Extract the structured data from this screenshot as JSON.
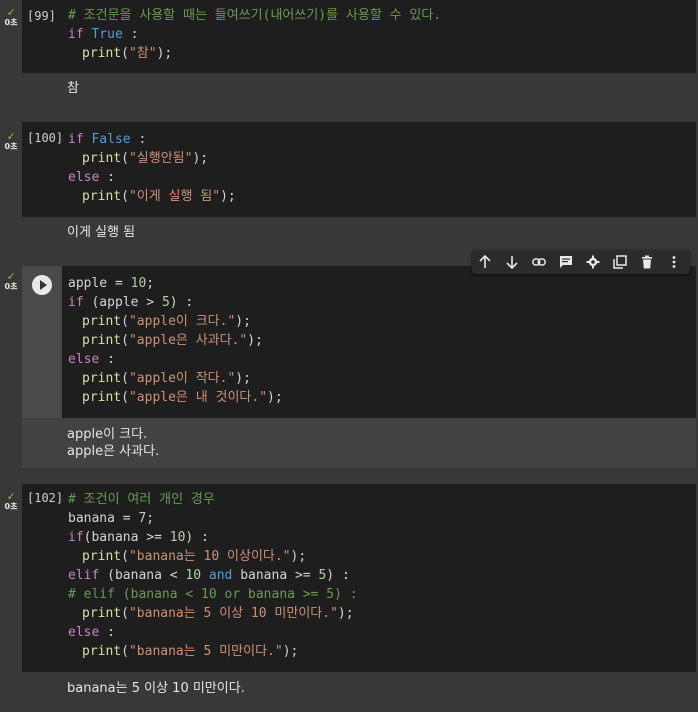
{
  "cells": [
    {
      "number": "[99]",
      "time": "0초",
      "output": [
        "참"
      ]
    },
    {
      "number": "[100]",
      "time": "0초",
      "output": [
        "이게 실행 됨"
      ]
    },
    {
      "number": "",
      "time": "0초",
      "output": [
        "apple이 크다.",
        "apple은 사과다."
      ]
    },
    {
      "number": "[102]",
      "time": "0초",
      "output": [
        "banana는 5 이상 10 미만이다."
      ]
    }
  ],
  "code": {
    "c1": {
      "l1": "# 조건문을 사용할 때는 들여쓰기(내어쓰기)를 사용할 수 있다.",
      "l2_kw": "if",
      "l2_val": "True",
      "l2_rest": " :",
      "l3_fn": "print",
      "l3_str": "\"참\""
    },
    "c2": {
      "l1_kw": "if",
      "l1_val": "False",
      "l1_rest": " :",
      "l2_fn": "print",
      "l2_str": "\"실행안됨\"",
      "l3_kw": "else",
      "l3_rest": " :",
      "l4_fn": "print",
      "l4_str": "\"이게 실행 됨\""
    },
    "c3": {
      "l1_a": "apple = ",
      "l1_n": "10",
      "l1_b": ";",
      "l2_kw": "if",
      "l2_a": " (apple > ",
      "l2_n": "5",
      "l2_b": ") :",
      "l3_fn": "print",
      "l3_str": "\"apple이 크다.\"",
      "l4_fn": "print",
      "l4_str": "\"apple은 사과다.\"",
      "l5_kw": "else",
      "l5_rest": " :",
      "l6_fn": "print",
      "l6_str": "\"apple이 작다.\"",
      "l7_fn": "print",
      "l7_str": "\"apple은 내 것이다.\""
    },
    "c4": {
      "l1": "# 조건이 여러 개인 경우",
      "l2_a": "banana = ",
      "l2_n": "7",
      "l2_b": ";",
      "l3_kw": "if",
      "l3_a": "(banana >= ",
      "l3_n": "10",
      "l3_b": ") :",
      "l4_fn": "print",
      "l4_str": "\"banana는 10 이상이다.\"",
      "l5_kw": "elif",
      "l5_a": " (banana < ",
      "l5_n1": "10",
      "l5_and": "and",
      "l5_b": " banana >= ",
      "l5_n2": "5",
      "l5_c": ") :",
      "l6": "# elif (banana < 10 or banana >= 5) :",
      "l7_fn": "print",
      "l7_str": "\"banana는 5 이상 10 미만이다.\"",
      "l8_kw": "else",
      "l8_rest": " :",
      "l9_fn": "print",
      "l9_str": "\"banana는 5 미만이다.\""
    }
  },
  "toolbar": {
    "icons": [
      "arrow-up-icon",
      "arrow-down-icon",
      "link-icon",
      "comment-icon",
      "gear-icon",
      "mirror-cell-icon",
      "trash-icon",
      "more-vert-icon"
    ]
  }
}
